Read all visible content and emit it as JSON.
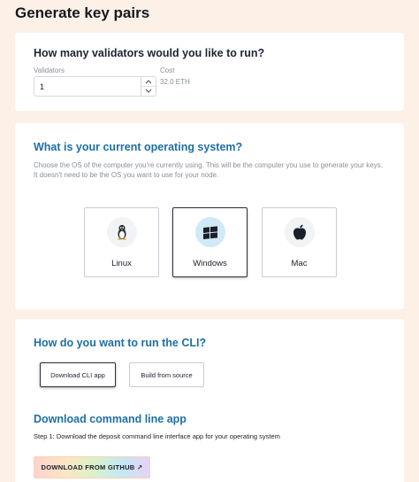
{
  "page": {
    "title": "Generate key pairs"
  },
  "validators": {
    "heading": "How many validators would you like to run?",
    "count_label": "Validators",
    "count_value": "1",
    "cost_label": "Cost",
    "cost_value": "32.0 ETH",
    "step_up_icon": "chevron-up-icon",
    "step_down_icon": "chevron-down-icon"
  },
  "os": {
    "heading": "What is your current operating system?",
    "description": "Choose the OS of the computer you're currently using. This will be the computer you use to generate your keys. It doesn't need to be the OS you want to use for your node.",
    "options": [
      {
        "label": "Linux",
        "icon": "linux-penguin-icon"
      },
      {
        "label": "Windows",
        "icon": "windows-logo-icon"
      },
      {
        "label": "Mac",
        "icon": "apple-logo-icon"
      }
    ],
    "selected": "Windows"
  },
  "cli": {
    "heading": "How do you want to run the CLI?",
    "options": [
      {
        "label": "Download CLI app"
      },
      {
        "label": "Build from source"
      }
    ],
    "selected": "Download CLI app",
    "download_heading": "Download command line app",
    "step_text": "Step 1: Download the deposit command line interface app for your operating system",
    "github_button": "DOWNLOAD FROM GITHUB ↗"
  },
  "colors": {
    "page_background": "#fdf0e6",
    "accent_heading": "#1d6fa5",
    "selected_icon_bg": "#cfe9f7"
  }
}
